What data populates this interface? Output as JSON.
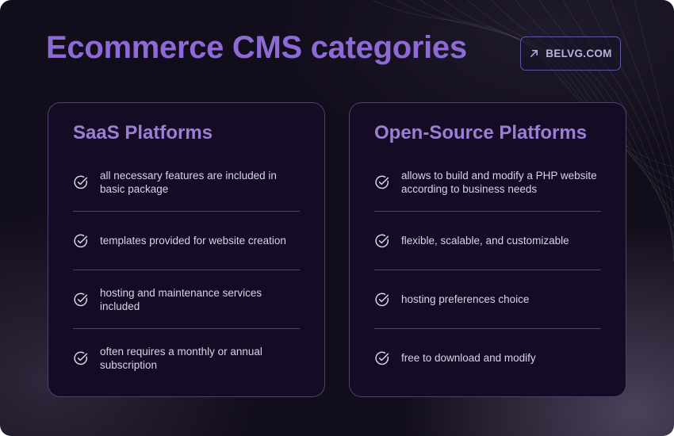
{
  "header": {
    "title": "Ecommerce CMS categories",
    "brand_label": "BELVG.COM"
  },
  "cards": [
    {
      "title": "SaaS Platforms",
      "items": [
        "all necessary features are included in basic package",
        "templates provided for website creation",
        "hosting and maintenance services included",
        "often requires a monthly or annual subscription"
      ]
    },
    {
      "title": "Open-Source Platforms",
      "items": [
        "allows to build and modify a PHP website according to business needs",
        "flexible, scalable, and customizable",
        "hosting preferences choice",
        "free to download and modify"
      ]
    }
  ],
  "icons": {
    "brand": "arrow-up-right-icon",
    "list": "check-circle-icon"
  },
  "colors": {
    "background": "#120d1b",
    "title": "#8e6ad6",
    "card_title": "#9a80d4",
    "card_bg": "#150b24",
    "text": "#d9d3e8",
    "brand_border": "#5f55a0"
  }
}
